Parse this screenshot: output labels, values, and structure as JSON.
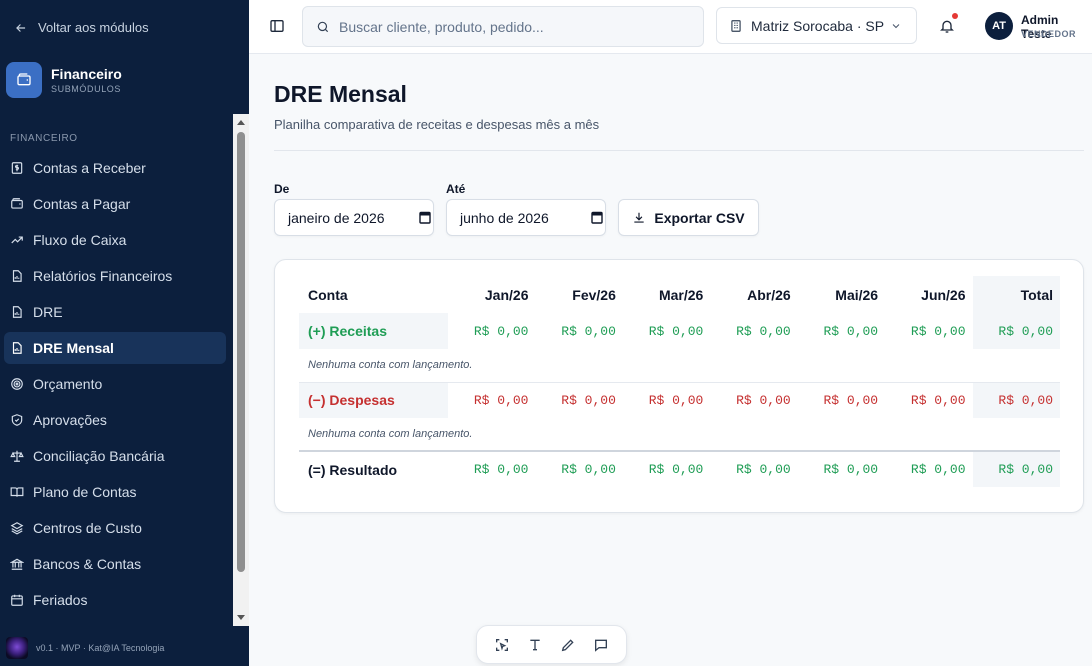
{
  "sidebar": {
    "back_label": "Voltar aos módulos",
    "module_title": "Financeiro",
    "module_subtitle": "SUBMÓDULOS",
    "section_label": "FINANCEIRO",
    "items": [
      {
        "label": "Contas a Receber",
        "icon": "dollar-doc-icon"
      },
      {
        "label": "Contas a Pagar",
        "icon": "wallet-icon"
      },
      {
        "label": "Fluxo de Caixa",
        "icon": "trend-up-icon"
      },
      {
        "label": "Relatórios Financeiros",
        "icon": "report-icon"
      },
      {
        "label": "DRE",
        "icon": "report-icon"
      },
      {
        "label": "DRE Mensal",
        "icon": "report-icon",
        "active": true
      },
      {
        "label": "Orçamento",
        "icon": "target-icon"
      },
      {
        "label": "Aprovações",
        "icon": "shield-check-icon"
      },
      {
        "label": "Conciliação Bancária",
        "icon": "scale-icon"
      },
      {
        "label": "Plano de Contas",
        "icon": "book-icon"
      },
      {
        "label": "Centros de Custo",
        "icon": "layers-icon"
      },
      {
        "label": "Bancos & Contas",
        "icon": "bank-icon"
      },
      {
        "label": "Feriados",
        "icon": "calendar-icon"
      }
    ],
    "footer_text": "v0.1 · MVP · Kat@IA Tecnologia"
  },
  "topbar": {
    "search_placeholder": "Buscar cliente, produto, pedido...",
    "branch": "Matriz Sorocaba · SP",
    "user_initials": "AT",
    "user_name": "Admin Teste",
    "user_role": "VENDEDOR"
  },
  "page": {
    "title": "DRE Mensal",
    "subtitle": "Planilha comparativa de receitas e despesas mês a mês"
  },
  "filters": {
    "from_label": "De",
    "from_value": "janeiro de 2026",
    "to_label": "Até",
    "to_value": "junho de 2026",
    "export_label": "Exportar CSV"
  },
  "table": {
    "headers": [
      "Conta",
      "Jan/26",
      "Fev/26",
      "Mar/26",
      "Abr/26",
      "Mai/26",
      "Jun/26",
      "Total"
    ],
    "receitas": {
      "label": "(+) Receitas",
      "values": [
        "R$ 0,00",
        "R$ 0,00",
        "R$ 0,00",
        "R$ 0,00",
        "R$ 0,00",
        "R$ 0,00",
        "R$ 0,00"
      ],
      "empty_text": "Nenhuma conta com lançamento."
    },
    "despesas": {
      "label": "(−) Despesas",
      "values": [
        "R$ 0,00",
        "R$ 0,00",
        "R$ 0,00",
        "R$ 0,00",
        "R$ 0,00",
        "R$ 0,00",
        "R$ 0,00"
      ],
      "empty_text": "Nenhuma conta com lançamento."
    },
    "resultado": {
      "label": "(=) Resultado",
      "values": [
        "R$ 0,00",
        "R$ 0,00",
        "R$ 0,00",
        "R$ 0,00",
        "R$ 0,00",
        "R$ 0,00",
        "R$ 0,00"
      ]
    }
  },
  "colors": {
    "sidebar_bg": "#0c1f3d",
    "positive": "#1f9d55",
    "negative": "#c53030"
  }
}
